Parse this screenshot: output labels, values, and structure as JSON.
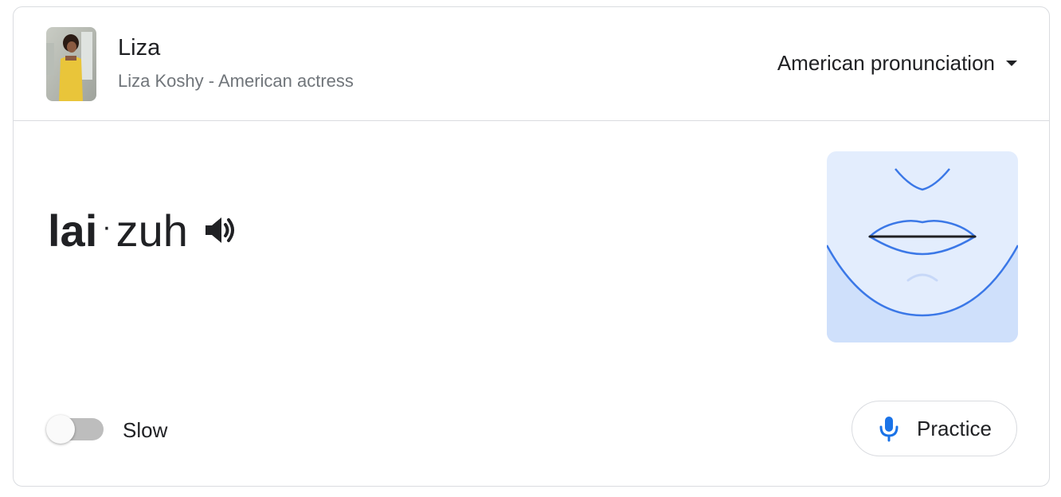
{
  "header": {
    "title": "Liza",
    "subtitle": "Liza Koshy - American actress",
    "accent_label": "American pronunciation"
  },
  "pronunciation": {
    "syllables": [
      "lai",
      "zuh"
    ],
    "separator": "·"
  },
  "controls": {
    "slow_label": "Slow",
    "slow_enabled": false,
    "practice_label": "Practice"
  },
  "icons": {
    "speaker": "speaker-icon",
    "mic": "microphone-icon",
    "dropdown": "caret-down-icon"
  },
  "colors": {
    "accent_blue": "#1a73e8",
    "mouth_bg_top": "#e3edfd",
    "mouth_bg_bottom": "#cfe0fb"
  }
}
